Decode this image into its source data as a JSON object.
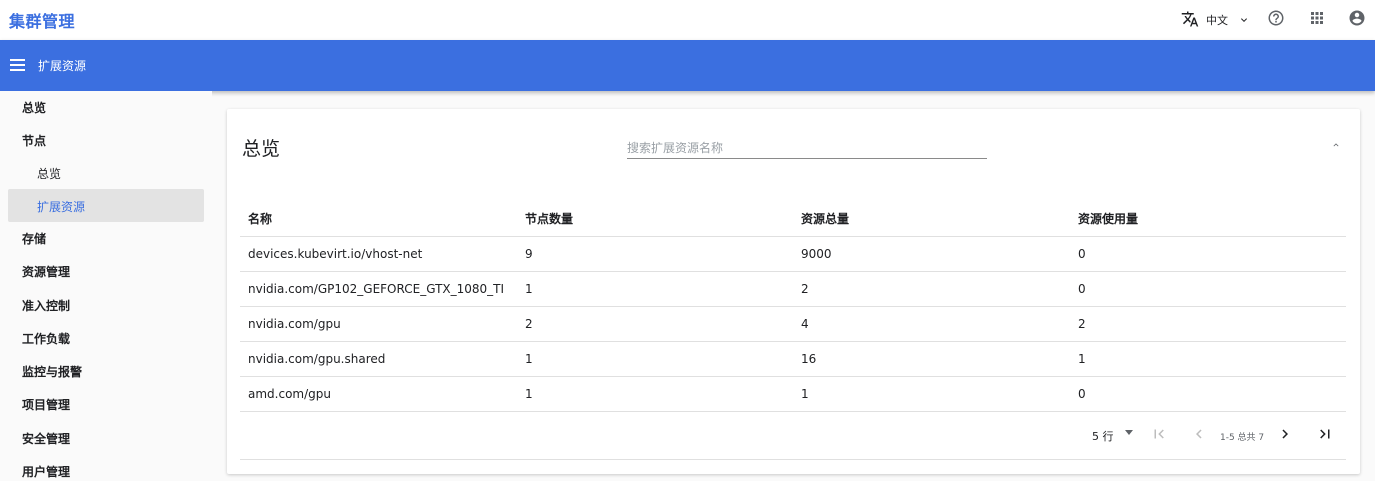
{
  "app": {
    "title": "集群管理"
  },
  "topbar": {
    "language": "中文",
    "icons": [
      "translate-icon",
      "chevron-down-icon",
      "help-icon",
      "apps-grid-icon",
      "account-icon"
    ]
  },
  "header": {
    "title": "扩展资源"
  },
  "sidebar": {
    "items": [
      {
        "label": "总览"
      },
      {
        "label": "节点"
      },
      {
        "label": "总览"
      },
      {
        "label": "扩展资源"
      },
      {
        "label": "存储"
      },
      {
        "label": "资源管理"
      },
      {
        "label": "准入控制"
      },
      {
        "label": "工作负载"
      },
      {
        "label": "监控与报警"
      },
      {
        "label": "项目管理"
      },
      {
        "label": "安全管理"
      },
      {
        "label": "用户管理"
      }
    ]
  },
  "card": {
    "title": "总览",
    "search_placeholder": "搜索扩展资源名称"
  },
  "table": {
    "headers": [
      "名称",
      "节点数量",
      "资源总量",
      "资源使用量"
    ],
    "rows": [
      [
        "devices.kubevirt.io/vhost-net",
        "9",
        "9000",
        "0"
      ],
      [
        "nvidia.com/GP102_GEFORCE_GTX_1080_TI",
        "1",
        "2",
        "0"
      ],
      [
        "nvidia.com/gpu",
        "2",
        "4",
        "2"
      ],
      [
        "nvidia.com/gpu.shared",
        "1",
        "16",
        "1"
      ],
      [
        "amd.com/gpu",
        "1",
        "1",
        "0"
      ]
    ]
  },
  "pagination": {
    "rows_per_page": "5 行",
    "range": "1-5 总共 7"
  },
  "colors": {
    "brand": "#3b6fe0",
    "active_bg": "#e3e3e3"
  }
}
